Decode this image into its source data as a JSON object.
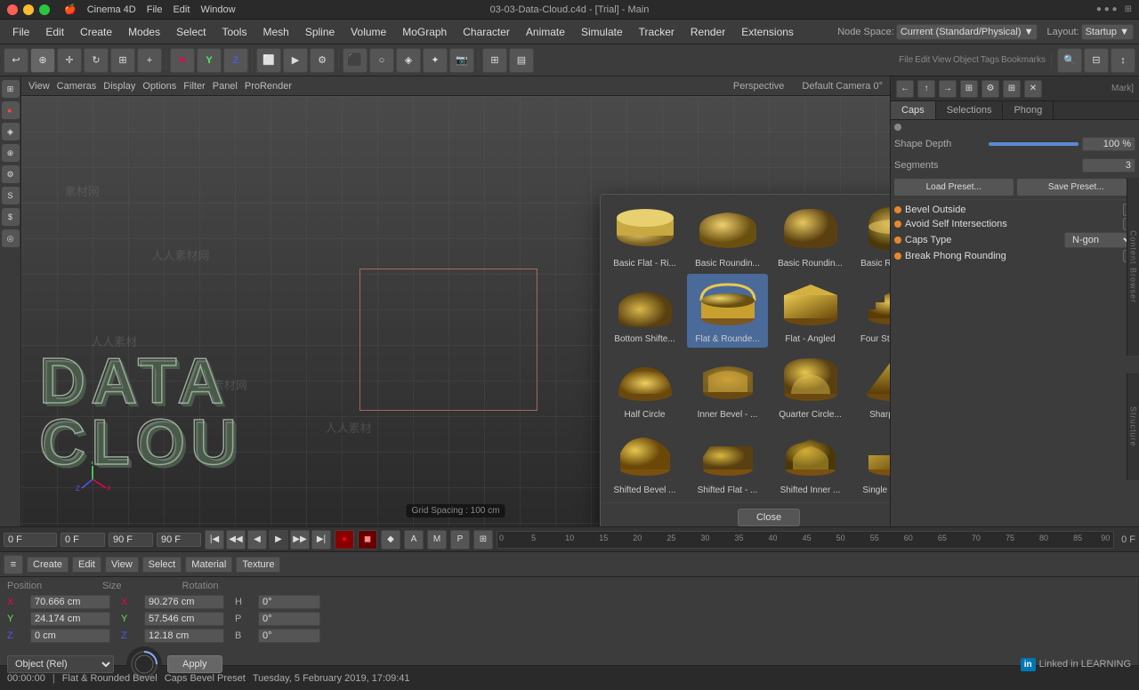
{
  "app": {
    "title": "Cinema 4D",
    "file_title": "03-03-Data-Cloud.c4d - [Trial] - Main"
  },
  "mac_menu": {
    "items": [
      "🍎",
      "Cinema 4D",
      "File",
      "Edit",
      "Window"
    ]
  },
  "menu_bar": {
    "items": [
      "File",
      "Edit",
      "Create",
      "Modes",
      "Select",
      "Tools",
      "Mesh",
      "Spline",
      "Volume",
      "MoGraph",
      "Character",
      "Animate",
      "Simulate",
      "Tracker",
      "Render",
      "Extensions"
    ]
  },
  "viewport": {
    "label": "Perspective",
    "camera": "Default Camera 0°",
    "header_items": [
      "View",
      "Cameras",
      "Display",
      "Options",
      "Filter",
      "Panel",
      "ProRender"
    ],
    "grid_spacing": "Grid Spacing : 100 cm",
    "text_3d_line1": "DATA",
    "text_3d_line2": "CLOU"
  },
  "caps_popup": {
    "title": "Caps Bevel Preset",
    "items": [
      {
        "label": "Basic Flat - Ri...",
        "row": 0,
        "col": 0
      },
      {
        "label": "Basic Roundin...",
        "row": 0,
        "col": 1
      },
      {
        "label": "Basic Roundin...",
        "row": 0,
        "col": 2
      },
      {
        "label": "Basic Roundin...",
        "row": 0,
        "col": 3
      },
      {
        "label": "Bottom Shifte...",
        "row": 1,
        "col": 0
      },
      {
        "label": "Flat & Rounde...",
        "row": 1,
        "col": 1,
        "selected": true
      },
      {
        "label": "Flat - Angled",
        "row": 1,
        "col": 2
      },
      {
        "label": "Four Steps - R...",
        "row": 1,
        "col": 3
      },
      {
        "label": "Half Circle",
        "row": 2,
        "col": 0
      },
      {
        "label": "Inner Bevel - ...",
        "row": 2,
        "col": 1
      },
      {
        "label": "Quarter Circle...",
        "row": 2,
        "col": 2
      },
      {
        "label": "Sharp Edge",
        "row": 2,
        "col": 3
      },
      {
        "label": "Shifted Bevel ...",
        "row": 3,
        "col": 0
      },
      {
        "label": "Shifted Flat - ...",
        "row": 3,
        "col": 1
      },
      {
        "label": "Shifted Inner ...",
        "row": 3,
        "col": 2
      },
      {
        "label": "Single Step - ...",
        "row": 3,
        "col": 3
      }
    ],
    "close_label": "Close"
  },
  "right_panel": {
    "tabs": [
      "Caps",
      "Selections",
      "Phong"
    ],
    "active_tab": "Caps",
    "shape_depth_label": "Shape Depth",
    "shape_depth_value": "100 %",
    "segments_label": "Segments",
    "segments_value": "3",
    "load_preset": "Load Preset...",
    "save_preset": "Save Preset...",
    "bevel_outside": "Bevel Outside",
    "avoid_self_intersections": "Avoid Self Intersections",
    "caps_type": "Caps Type",
    "caps_type_value": "N-gon",
    "break_phong": "Break Phong Rounding"
  },
  "properties_panel": {
    "position_label": "Position",
    "size_label": "Size",
    "rotation_label": "Rotation",
    "x_pos": "70.666 cm",
    "y_pos": "24.174 cm",
    "z_pos": "0 cm",
    "x_size": "90.276 cm",
    "y_size": "57.546 cm",
    "z_size": "12.18 cm",
    "h_rot": "0°",
    "p_rot": "0°",
    "b_rot": "0°",
    "apply_label": "Apply",
    "object_dropdown": "Object (Rel)"
  },
  "timeline": {
    "current_frame": "0 F",
    "start_frame": "0 F",
    "end_frame": "90 F",
    "end_frame2": "90 F",
    "markers": [
      "0",
      "5",
      "10",
      "15",
      "20",
      "25",
      "30",
      "35",
      "40",
      "45",
      "50",
      "55",
      "60",
      "65",
      "70",
      "75",
      "80",
      "85",
      "90"
    ]
  },
  "status_bar": {
    "time": "00:00:00",
    "preset_name": "Flat & Rounded Bevel",
    "info": "Caps Bevel Preset",
    "date": "Tuesday, 5 February 2019, 17:09:41"
  },
  "bottom_toolbar": {
    "items": [
      "Create",
      "Edit",
      "View",
      "Select",
      "Material",
      "Texture"
    ]
  },
  "linked_in": "Linked in LEARNING"
}
